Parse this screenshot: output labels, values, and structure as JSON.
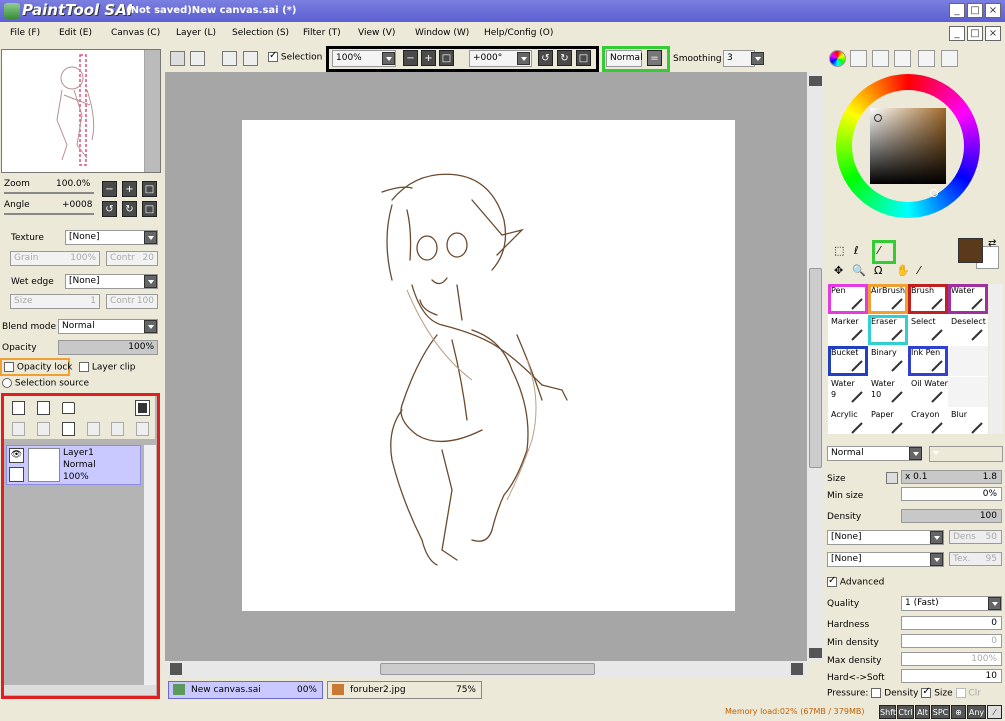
{
  "titlebar": {
    "app": "PaintTool SAI",
    "document": "(Not saved)New canvas.sai (*)",
    "minimize": "_",
    "maximize": "□",
    "close": "×"
  },
  "menu": [
    "File (F)",
    "Edit (E)",
    "Canvas (C)",
    "Layer (L)",
    "Selection (S)",
    "Filter (T)",
    "View (V)",
    "Window (W)",
    "Help/Config (O)"
  ],
  "toolbar": {
    "selection_label": "Selection",
    "zoom": "100%",
    "angle": "+000°",
    "blend": "Normal",
    "smoothing_label": "Smoothing",
    "smoothing_value": "3"
  },
  "navigator": {
    "zoom_label": "Zoom",
    "zoom_value": "100.0%",
    "angle_label": "Angle",
    "angle_value": "+0008"
  },
  "texture": {
    "label": "Texture",
    "value": "[None]",
    "grain_label": "Grain",
    "grain_value": "100%",
    "contr_label": "Contr",
    "contr_value": "20"
  },
  "wetedge": {
    "label": "Wet edge",
    "value": "[None]",
    "size_label": "Size",
    "size_value": "1",
    "contr_label": "Contr",
    "contr_value": "100"
  },
  "layer_props": {
    "blend_label": "Blend mode",
    "blend_value": "Normal",
    "opacity_label": "Opacity",
    "opacity_value": "100%",
    "opacity_lock": "Opacity lock",
    "layer_clip": "Layer clip",
    "selection_source": "Selection source"
  },
  "layer": {
    "name": "Layer1",
    "mode": "Normal",
    "opacity": "100%"
  },
  "tabs": [
    {
      "name": "New canvas.sai",
      "zoom": "00%"
    },
    {
      "name": "foruber2.jpg",
      "zoom": "75%"
    }
  ],
  "tools": [
    {
      "label": "Pen",
      "color": "#e23be2"
    },
    {
      "label": "AirBrush",
      "color": "#f0a030"
    },
    {
      "label": "Brush",
      "color": "#c02020"
    },
    {
      "label": "Water",
      "color": "#a030a0"
    },
    {
      "label": "Marker"
    },
    {
      "label": "Eraser",
      "color": "#30d0d0"
    },
    {
      "label": "Select"
    },
    {
      "label": "Deselect"
    },
    {
      "label": "Bucket",
      "color": "#2040c0"
    },
    {
      "label": "Binary"
    },
    {
      "label": "Ink Pen",
      "color": "#3040d0"
    },
    {
      "label": ""
    },
    {
      "label": "Water",
      "size": "9"
    },
    {
      "label": "Water",
      "size": "10"
    },
    {
      "label": "Oil Water"
    },
    {
      "label": ""
    },
    {
      "label": "Acrylic"
    },
    {
      "label": "Paper"
    },
    {
      "label": "Crayon"
    },
    {
      "label": "Blur"
    }
  ],
  "brush": {
    "blend": "Normal",
    "size_label": "Size",
    "size_mult": "x 0.1",
    "size_value": "1.8",
    "minsize_label": "Min size",
    "minsize_value": "0%",
    "density_label": "Density",
    "density_value": "100",
    "tex1": "[None]",
    "dens_label": "Dens",
    "dens_value": "50",
    "tex2": "[None]",
    "tex_label": "Tex.",
    "tex_value": "95",
    "advanced": "Advanced",
    "quality_label": "Quality",
    "quality_value": "1 (Fast)",
    "hardness_label": "Hardness",
    "hardness_value": "0",
    "mindensity_label": "Min density",
    "mindensity_value": "0",
    "maxdens_label": "Max density",
    "maxdens_value": "100%",
    "hardsoft_label": "Hard<->Soft",
    "hardsoft_value": "10",
    "pressure_label": "Pressure:",
    "density_chk": "Density",
    "size_chk": "Size",
    "clr_chk": "Clr"
  },
  "status": {
    "memory": "Memory load:02% (67MB / 379MB)",
    "keys": [
      "Shft",
      "Ctrl",
      "Alt",
      "SPC",
      "⊕",
      "Any",
      "⁄"
    ]
  },
  "colors": {
    "highlight_black": "#000000",
    "highlight_green": "#33cc33",
    "highlight_orange": "#f0a030",
    "highlight_red": "#e02020",
    "brown": "#5a3a1a"
  }
}
